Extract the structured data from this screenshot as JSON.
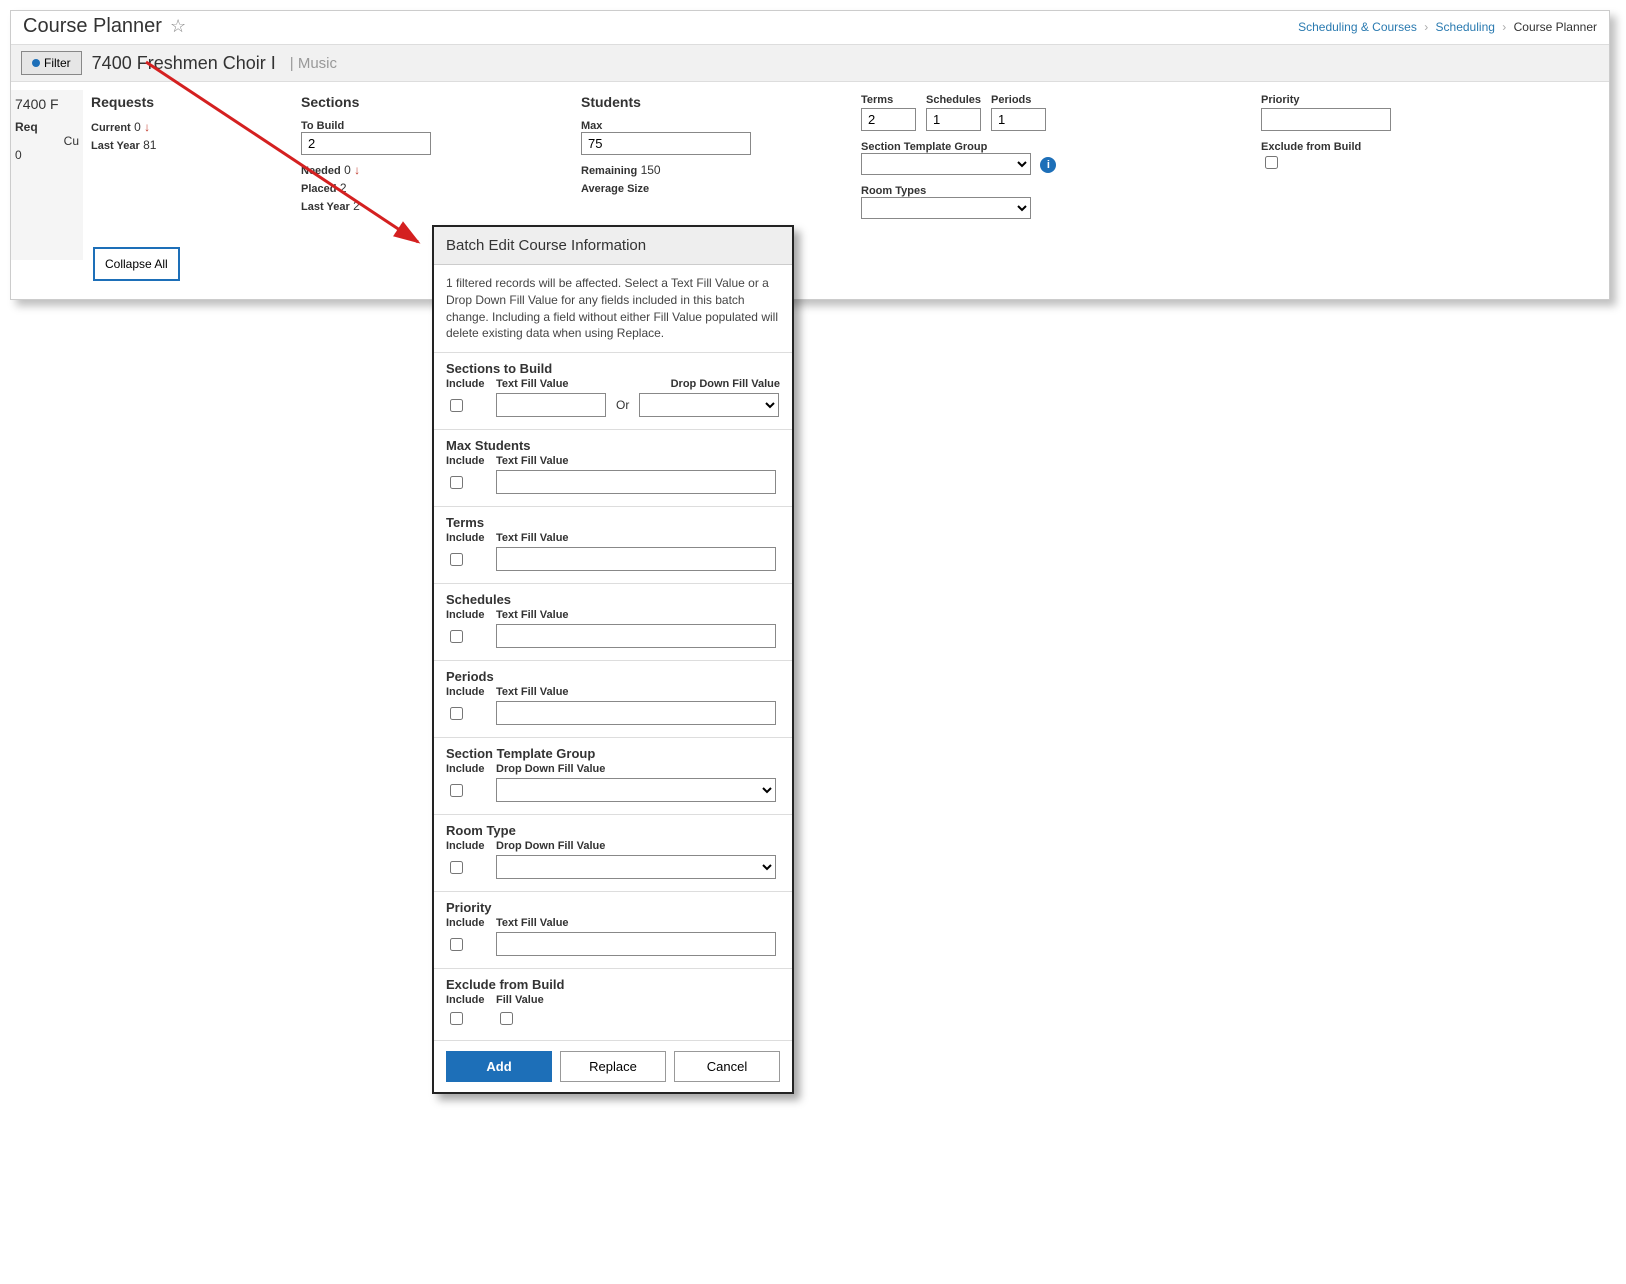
{
  "header": {
    "title": "Course Planner",
    "breadcrumb": {
      "item1": "Scheduling & Courses",
      "item2": "Scheduling",
      "item3": "Course Planner"
    }
  },
  "subheader": {
    "filter_label": "Filter",
    "course_code_name": "7400 Freshmen Choir I",
    "dept_separator": "| Music"
  },
  "leftstub": {
    "line1": "7400 F",
    "line2": "Req",
    "line3": "Cu",
    "line4": "0"
  },
  "requests": {
    "heading": "Requests",
    "current_label": "Current",
    "current_value": "0",
    "lastyear_label": "Last Year",
    "lastyear_value": "81"
  },
  "sections": {
    "heading": "Sections",
    "tobuild_label": "To Build",
    "tobuild_value": "2",
    "needed_label": "Needed",
    "needed_value": "0",
    "placed_label": "Placed",
    "placed_value": "2",
    "lastyear_label": "Last Year",
    "lastyear_value": "2"
  },
  "students": {
    "heading": "Students",
    "max_label": "Max",
    "max_value": "75",
    "remaining_label": "Remaining",
    "remaining_value": "150",
    "avg_label": "Average Size"
  },
  "rightcol": {
    "terms_label": "Terms",
    "terms_value": "2",
    "schedules_label": "Schedules",
    "schedules_value": "1",
    "periods_label": "Periods",
    "periods_value": "1",
    "stg_label": "Section Template Group",
    "roomtypes_label": "Room Types"
  },
  "farright": {
    "priority_label": "Priority",
    "exclude_label": "Exclude from Build"
  },
  "collapse_label": "Collapse All",
  "dialog": {
    "title": "Batch Edit Course Information",
    "desc": "1 filtered records will be affected. Select a Text Fill Value or a Drop Down Fill Value for any fields included in this batch change. Including a field without either Fill Value populated will delete existing data when using Replace.",
    "labels": {
      "include": "Include",
      "text_fill": "Text Fill Value",
      "dd_fill": "Drop Down Fill Value",
      "fill_value": "Fill Value",
      "or": "Or"
    },
    "sections": {
      "sections_to_build": "Sections to Build",
      "max_students": "Max Students",
      "terms": "Terms",
      "schedules": "Schedules",
      "periods": "Periods",
      "stg": "Section Template Group",
      "room_type": "Room Type",
      "priority": "Priority",
      "exclude": "Exclude from Build"
    },
    "buttons": {
      "add": "Add",
      "replace": "Replace",
      "cancel": "Cancel"
    }
  }
}
